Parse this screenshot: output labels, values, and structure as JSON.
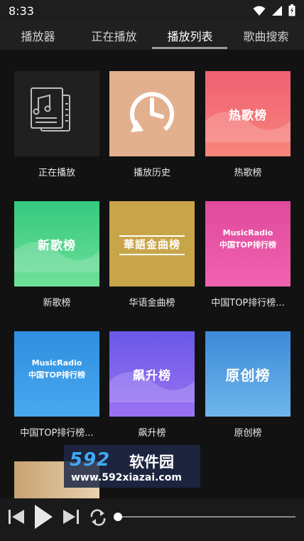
{
  "status_bar": {
    "time": "8:33"
  },
  "tabs": [
    {
      "label": "播放器"
    },
    {
      "label": "正在播放"
    },
    {
      "label": "播放列表"
    },
    {
      "label": "歌曲搜索"
    }
  ],
  "active_tab": "播放列表",
  "tiles": [
    {
      "label": "正在播放",
      "icon": "music-document-icon",
      "bg": "#202020"
    },
    {
      "label": "播放历史",
      "icon": "history-clock-icon",
      "bg": "#e3b08f"
    },
    {
      "label": "热歌榜",
      "cover_text": "热歌榜",
      "bg_top": "#f06074",
      "bg_bottom": "#f7857a"
    },
    {
      "label": "新歌榜",
      "cover_text": "新歌榜",
      "bg_top": "#35c97f",
      "bg_bottom": "#6fdf98"
    },
    {
      "label": "华语金曲榜",
      "cover_text": "華語金曲榜",
      "bg": "#c9a54a"
    },
    {
      "label": "中国TOP排行榜...",
      "cover_line1": "MusicRadio",
      "cover_line2": "中国TOP排行榜",
      "bg_top": "#e04a9c",
      "bg_bottom": "#f062b0"
    },
    {
      "label": "中国TOP排行榜...",
      "cover_line1": "MusicRadio",
      "cover_line2": "中国TOP排行榜",
      "bg_top": "#2f8fe0",
      "bg_bottom": "#48a8ef"
    },
    {
      "label": "飙升榜",
      "cover_text": "飙升榜",
      "bg_top": "#6a58e8",
      "bg_bottom": "#9a72f2"
    },
    {
      "label": "原创榜",
      "cover_text": "原创榜",
      "bg_top": "#3c8ad8",
      "bg_bottom": "#6fb6ec"
    }
  ],
  "watermark": {
    "logo": "592",
    "name": "软件园",
    "url": "www.592xiazai.com"
  },
  "player": {
    "controls": [
      "skip-previous-icon",
      "play-icon",
      "skip-next-icon",
      "repeat-icon"
    ],
    "progress": 0
  }
}
